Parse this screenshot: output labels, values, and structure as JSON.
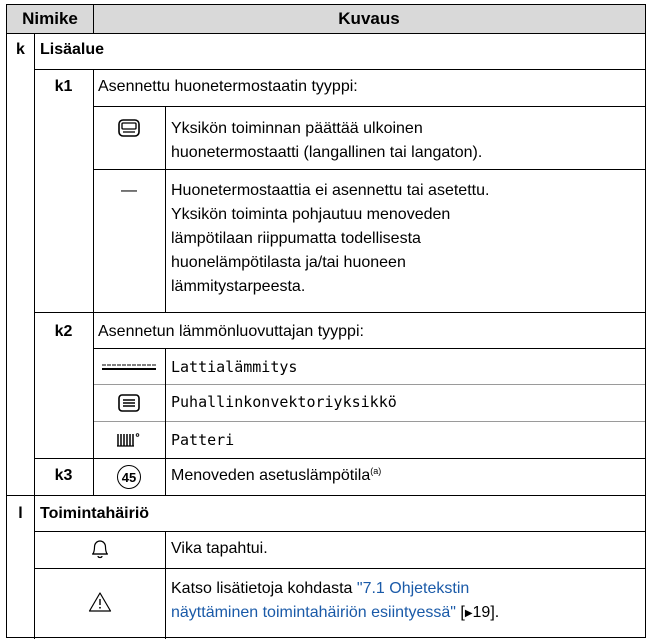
{
  "header": {
    "col1": "Nimike",
    "col2": "Kuvaus"
  },
  "k": {
    "letter": "k",
    "title": "Lisäalue",
    "k1": {
      "code": "k1",
      "desc": "Asennettu huonetermostaatin tyyppi:",
      "opt1": {
        "icon": "room-thermostat-icon",
        "line1": "Yksikön toiminnan päättää ulkoinen",
        "line2": "huonetermostaatti (langallinen tai langaton)."
      },
      "opt2": {
        "symbol": "—",
        "line1": "Huonetermostaattia ei asennettu tai asetettu.",
        "line2": "Yksikön toiminta pohjautuu menoveden",
        "line3": "lämpötilaan riippumatta todellisesta",
        "line4": "huonelämpötilasta ja/tai huoneen",
        "line5": "lämmitystarpeesta."
      }
    },
    "k2": {
      "code": "k2",
      "desc": "Asennetun lämmönluovuttajan tyyppi:",
      "opt1": {
        "icon": "underfloor-heating-icon",
        "label": "Lattialämmitys"
      },
      "opt2": {
        "icon": "fan-coil-icon",
        "label": "Puhallinkonvektoriyksikkö"
      },
      "opt3": {
        "icon": "radiator-icon",
        "label": "Patteri"
      }
    },
    "k3": {
      "code": "k3",
      "icon_value": "45",
      "desc": "Menoveden asetuslämpötila",
      "sup": "(a)"
    }
  },
  "l": {
    "letter": "l",
    "title": "Toimintahäiriö",
    "opt1": {
      "icon": "bell-icon",
      "text": "Vika tapahtui."
    },
    "opt2": {
      "icon": "warning-icon",
      "line1_prefix": "Katso lisätietoja kohdasta ",
      "line1_link": "\"7.1 Ohjetekstin",
      "line2_link": "näyttäminen toimintahäiriön esiintyessä\"",
      "line2_suffix1": " [",
      "page_ref": "19",
      "line2_suffix2": "]."
    }
  }
}
